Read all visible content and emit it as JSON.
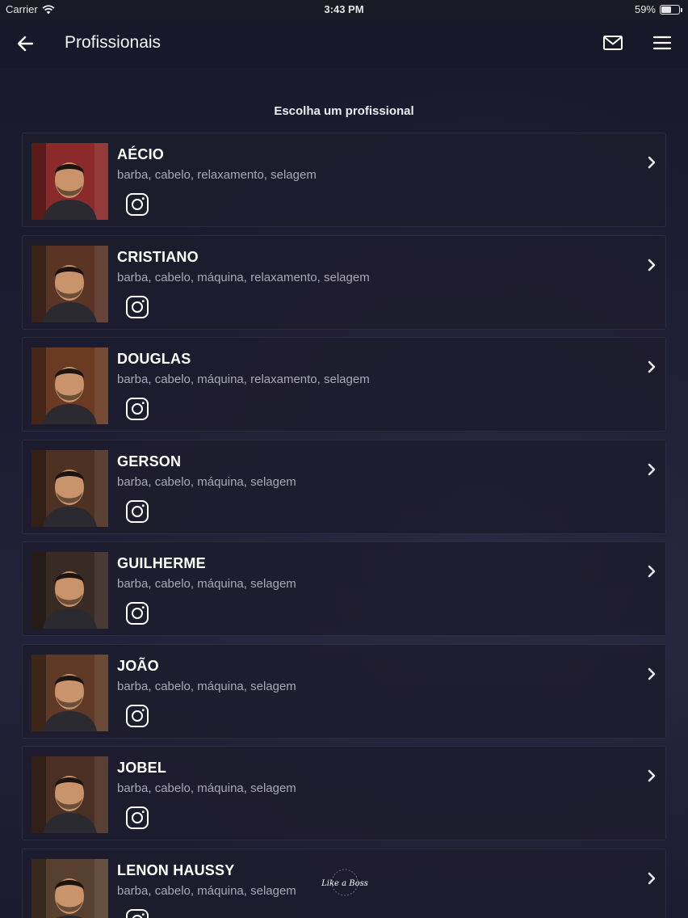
{
  "status_bar": {
    "carrier": "Carrier",
    "time": "3:43 PM",
    "battery": "59%",
    "battery_level": 0.59
  },
  "nav": {
    "title": "Profissionais",
    "back_icon": "arrow-left-icon",
    "mail_icon": "mail-icon",
    "menu_icon": "hamburger-menu-icon"
  },
  "section_title": "Escolha um profissional",
  "professionals": [
    {
      "name": "AÉCIO",
      "services": "barba, cabelo, relaxamento, selagem",
      "bg": "#8a2a2a"
    },
    {
      "name": "CRISTIANO",
      "services": "barba, cabelo, máquina, relaxamento, selagem",
      "bg": "#5a3526"
    },
    {
      "name": "DOUGLAS",
      "services": "barba, cabelo, máquina, relaxamento, selagem",
      "bg": "#6a3a22"
    },
    {
      "name": "GERSON",
      "services": "barba, cabelo, máquina, selagem",
      "bg": "#4d3122"
    },
    {
      "name": "GUILHERME",
      "services": "barba, cabelo, máquina, selagem",
      "bg": "#3a2a24"
    },
    {
      "name": "JOÃO",
      "services": "barba, cabelo, máquina, selagem",
      "bg": "#5e3a26"
    },
    {
      "name": "JOBEL",
      "services": "barba, cabelo, máquina, selagem",
      "bg": "#4a3024"
    },
    {
      "name": "LENON HAUSSY",
      "services": "barba, cabelo, máquina, selagem",
      "bg": "#574030"
    }
  ],
  "watermark": "Like a Boss",
  "colors": {
    "background": "#1b1a2e",
    "card_border": "#2c2b40",
    "secondary_text": "#a9a8b6"
  }
}
